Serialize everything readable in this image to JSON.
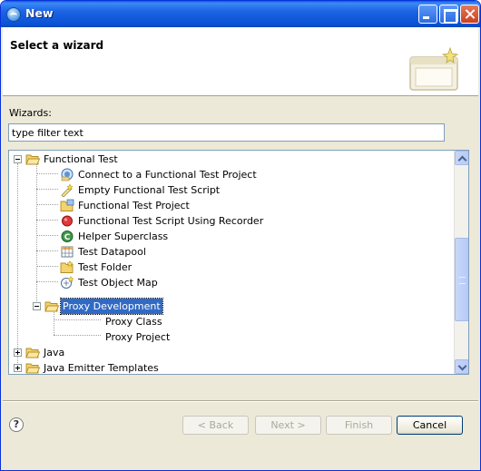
{
  "window": {
    "title": "New"
  },
  "header": {
    "title": "Select a wizard"
  },
  "wizards": {
    "label": "Wizards:",
    "filter_value": "type filter text"
  },
  "tree": {
    "items": [
      {
        "label": "Functional Test",
        "level": 0,
        "expanded": true,
        "icon": "folder-open-icon"
      },
      {
        "label": "Connect to a Functional Test Project",
        "level": 1,
        "icon": "connect-project-icon"
      },
      {
        "label": "Empty Functional Test Script",
        "level": 1,
        "icon": "empty-script-icon"
      },
      {
        "label": "Functional Test Project",
        "level": 1,
        "icon": "project-icon"
      },
      {
        "label": "Functional Test Script Using Recorder",
        "level": 1,
        "icon": "record-icon"
      },
      {
        "label": "Helper Superclass",
        "level": 1,
        "icon": "helper-class-icon"
      },
      {
        "label": "Test Datapool",
        "level": 1,
        "icon": "datapool-icon"
      },
      {
        "label": "Test Folder",
        "level": 1,
        "icon": "folder-icon"
      },
      {
        "label": "Test Object Map",
        "level": 1,
        "icon": "object-map-icon"
      },
      {
        "label": "Proxy Development",
        "level": 1,
        "expanded": true,
        "selected": true,
        "icon": "folder-open-icon"
      },
      {
        "label": "Proxy Class",
        "level": 2
      },
      {
        "label": "Proxy Project",
        "level": 2
      },
      {
        "label": "Java",
        "level": 0,
        "expanded": false,
        "icon": "folder-icon"
      },
      {
        "label": "Java Emitter Templates",
        "level": 0,
        "expanded": false,
        "icon": "folder-icon"
      }
    ]
  },
  "buttons": {
    "help": "?",
    "back": "< Back",
    "next": "Next >",
    "finish": "Finish",
    "cancel": "Cancel"
  },
  "colors": {
    "titlebar": "#0b53d6",
    "selection": "#316ac5",
    "folder": "#f5d66b"
  }
}
